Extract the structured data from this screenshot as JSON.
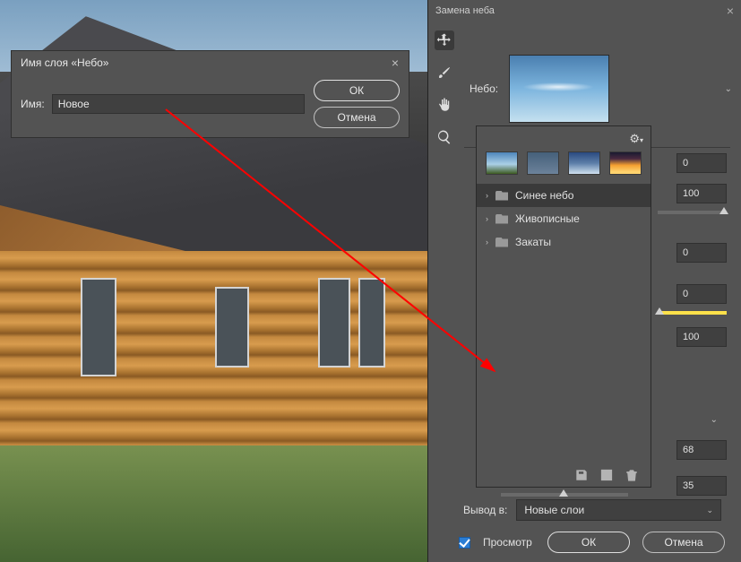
{
  "canvas": {
    "description": "wooden log house with dark roof, grass foreground, blue sky"
  },
  "rename_dialog": {
    "title": "Имя слоя «Небо»",
    "name_label": "Имя:",
    "name_value": "Новое",
    "ok_label": "ОК",
    "cancel_label": "Отмена"
  },
  "sky_panel": {
    "title": "Замена неба",
    "sky_label": "Небо:",
    "tools": [
      "move",
      "brush",
      "hand",
      "zoom"
    ],
    "sliders": [
      {
        "id": "s1",
        "value": "0"
      },
      {
        "id": "s2",
        "value": "100"
      },
      {
        "id": "s3",
        "value": "0"
      },
      {
        "id": "s4",
        "value": "0"
      },
      {
        "id": "s5",
        "value": "100"
      },
      {
        "id": "s6",
        "value": "68"
      },
      {
        "id": "s7",
        "value": "35"
      }
    ],
    "output_label": "Вывод в:",
    "output_value": "Новые слои",
    "preview_label": "Просмотр",
    "preview_checked": true,
    "ok_label": "ОК",
    "cancel_label": "Отмена"
  },
  "preset_popup": {
    "thumbs": [
      "blue-landscape",
      "overcast",
      "blue-gradient",
      "sunset"
    ],
    "categories": [
      {
        "label": "Синее небо",
        "selected": true
      },
      {
        "label": "Живописные",
        "selected": false
      },
      {
        "label": "Закаты",
        "selected": false
      }
    ],
    "footer_icons": [
      "save-icon",
      "new-icon",
      "trash-icon"
    ]
  }
}
